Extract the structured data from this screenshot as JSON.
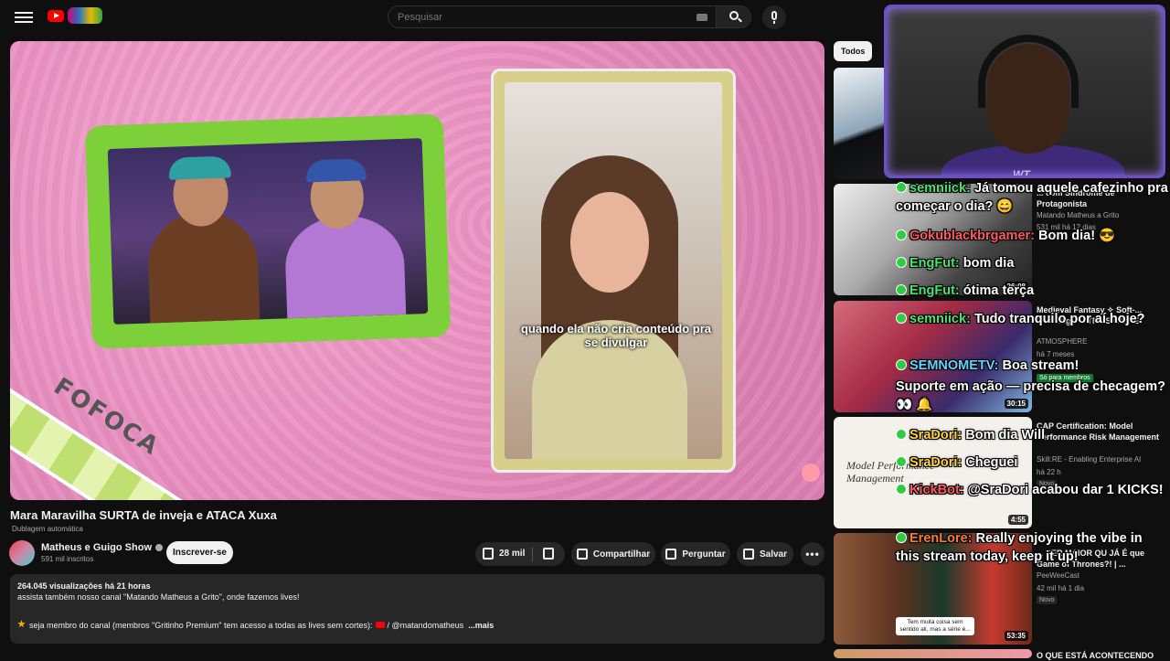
{
  "header": {
    "search_placeholder": "Pesquisar"
  },
  "video": {
    "caption": "quando ela não cria conteúdo pra se divulgar",
    "overlay_text": "FOFOCA",
    "title": "Mara Maravilha SURTA de inveja e ATACA Xuxa",
    "dubbing": "Dublagem automática"
  },
  "channel": {
    "name": "Matheus e Guigo Show",
    "subscribers": "591 mil inscritos",
    "subscribe_label": "Inscrever-se"
  },
  "actions": {
    "likes": "28 mil",
    "share_label": "Compartilhar",
    "ask_label": "Perguntar",
    "save_label": "Salvar"
  },
  "description": {
    "stats": "264.045 visualizações  há 21 horas",
    "line1": "assista também nosso canal  \"Matando Matheus a Grito\", onde fazemos lives!",
    "line2": "seja membro do canal (membros \"Gritinho Premium\" tem acesso a todas as lives sem cortes):",
    "link": "/ @matandomatheus",
    "more": "...mais"
  },
  "sidebar": {
    "chip": "Todos",
    "recs": [
      {
        "title": "... com Síndrome de Protagonista",
        "channel": "Matando Matheus a Grito",
        "meta": "531 mil  há 12 dias",
        "duration": "26:08"
      },
      {
        "title": "Medieval Fantasy ✧ Soft-... Relaxing ✧ ATMOSPHERE",
        "channel": "ATMOSPHERE",
        "meta": "há 7 meses",
        "badge": "Só para membros",
        "duration": "30:15"
      },
      {
        "title": "CAP Certification: Model Performance Risk Management",
        "channel": "Skill:RE - Enabling Enterprise AI",
        "meta": "há 22 h",
        "badge": "Novo",
        "duration": "4:55",
        "thumb_text": "Model Performance Management"
      },
      {
        "title": "... SER MAIOR QU JÁ É que Game of Thrones?! | ...",
        "channel": "PeeWeeCast",
        "meta": "42 mil  há 1 dia",
        "badge": "Novo",
        "duration": "53:35",
        "thumb_caption": "Tem muita coisa sem sentido ali, mas a série é..."
      },
      {
        "title": "O QUE ESTÁ ACONTECENDO"
      }
    ]
  },
  "webcam": {
    "logo": "WT"
  },
  "chat": [
    {
      "user": "semniick:",
      "text": "Já tomou aquele cafezinho pra começar o dia? 😄",
      "color": "green"
    },
    {
      "user": "Gokublackbrgamer:",
      "text": "Bom dia! 😎",
      "color": "red"
    },
    {
      "user": "EngFut:",
      "text": "bom dia",
      "color": "green"
    },
    {
      "user": "EngFut:",
      "text": "ótima terça",
      "color": "green"
    },
    {
      "user": "semniick:",
      "text": "Tudo tranquilo por aí hoje?",
      "color": "green"
    },
    {
      "user": "SEMNOMETV:",
      "text": "Boa stream!",
      "color": "cyan"
    },
    {
      "user": "",
      "text": "Suporte em ação — precisa de checagem? 👀 🔔",
      "color": "white"
    },
    {
      "user": "SraDori:",
      "text": "Bom dia Will",
      "color": "yellow"
    },
    {
      "user": "SraDori:",
      "text": "Cheguei",
      "color": "yellow"
    },
    {
      "user": "KickBot:",
      "text": "@SraDori acabou dar 1 KICKS!",
      "color": "red"
    },
    {
      "user": "ErenLore:",
      "text": "Really enjoying the vibe in this stream today, keep it up!",
      "color": "orange"
    }
  ]
}
